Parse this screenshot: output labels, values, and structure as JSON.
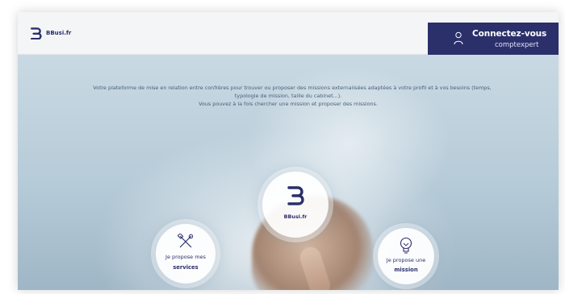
{
  "brand": {
    "name": "BBusi.fr"
  },
  "header": {
    "connect_line1": "Connectez-vous",
    "connect_line2": "comptexpert"
  },
  "tagline": {
    "line1": "Votre plateforme de mise en relation entre confrères pour trouver ou proposer des missions externalisées adaptées à votre profil et à vos besoins (temps,",
    "line2": "typologie de mission, taille du cabinet...).",
    "line3": "Vous pouvez à la fois chercher une mission et proposer des missions."
  },
  "bubbles": {
    "center_label": "BBusi.fr",
    "left_line1": "Je propose mes",
    "left_line2": "services",
    "right_line1": "Je propose une",
    "right_line2": "mission"
  },
  "colors": {
    "brand_navy": "#2b2f6a",
    "text_blue": "#4a5f78"
  },
  "icons": [
    "b-logo-icon",
    "user-icon",
    "tools-icon",
    "lightbulb-icon"
  ]
}
